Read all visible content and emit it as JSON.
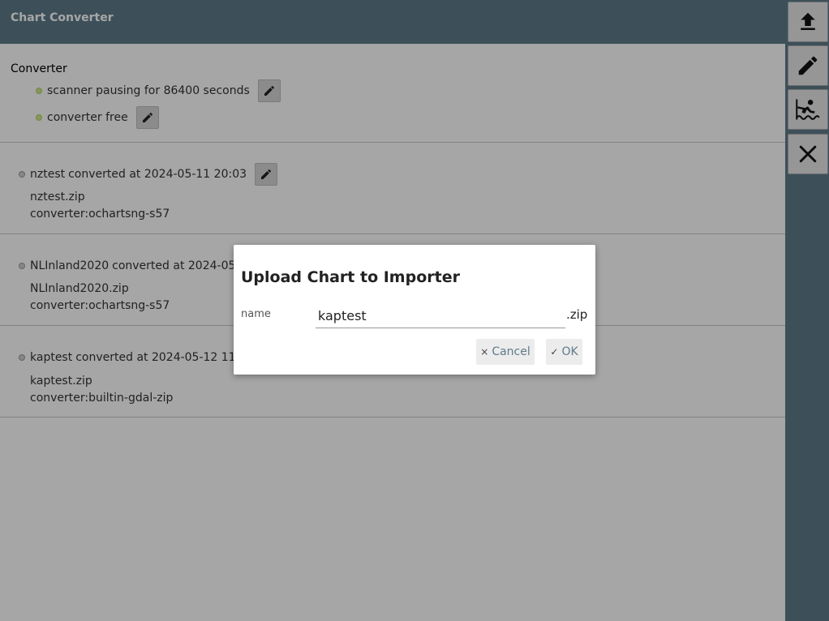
{
  "header": {
    "title": "Chart Converter"
  },
  "converter": {
    "title": "Converter",
    "statuses": [
      {
        "text": "scanner pausing for 86400 seconds",
        "color": "#cfe58a"
      },
      {
        "text": "converter free",
        "color": "#cfe58a"
      }
    ]
  },
  "charts": [
    {
      "name": "nztest",
      "status": "converted at 2024-05-11 20:03",
      "file": "nztest.zip",
      "converter": "converter:ochartsng-s57"
    },
    {
      "name": "NLInland2020",
      "status": "converted at 2024-05",
      "file": "NLInland2020.zip",
      "converter": "converter:ochartsng-s57"
    },
    {
      "name": "kaptest",
      "status": "converted at 2024-05-12 11",
      "file": "kaptest.zip",
      "converter": "converter:builtin-gdal-zip"
    }
  ],
  "toolbar": {
    "buttons": [
      {
        "icon": "upload-icon"
      },
      {
        "icon": "edit-icon"
      },
      {
        "icon": "chart-icon"
      },
      {
        "icon": "close-icon"
      }
    ]
  },
  "dialog": {
    "title": "Upload Chart to Importer",
    "name_label": "name",
    "name_value": "kaptest",
    "suffix": ".zip",
    "cancel_label": "Cancel",
    "cancel_icon": "×",
    "ok_label": "OK",
    "ok_icon": "✓"
  },
  "colors": {
    "header_bg": "#5e7b8a",
    "status_ok": "#cfe58a",
    "status_idle": "#d0d0d0"
  }
}
